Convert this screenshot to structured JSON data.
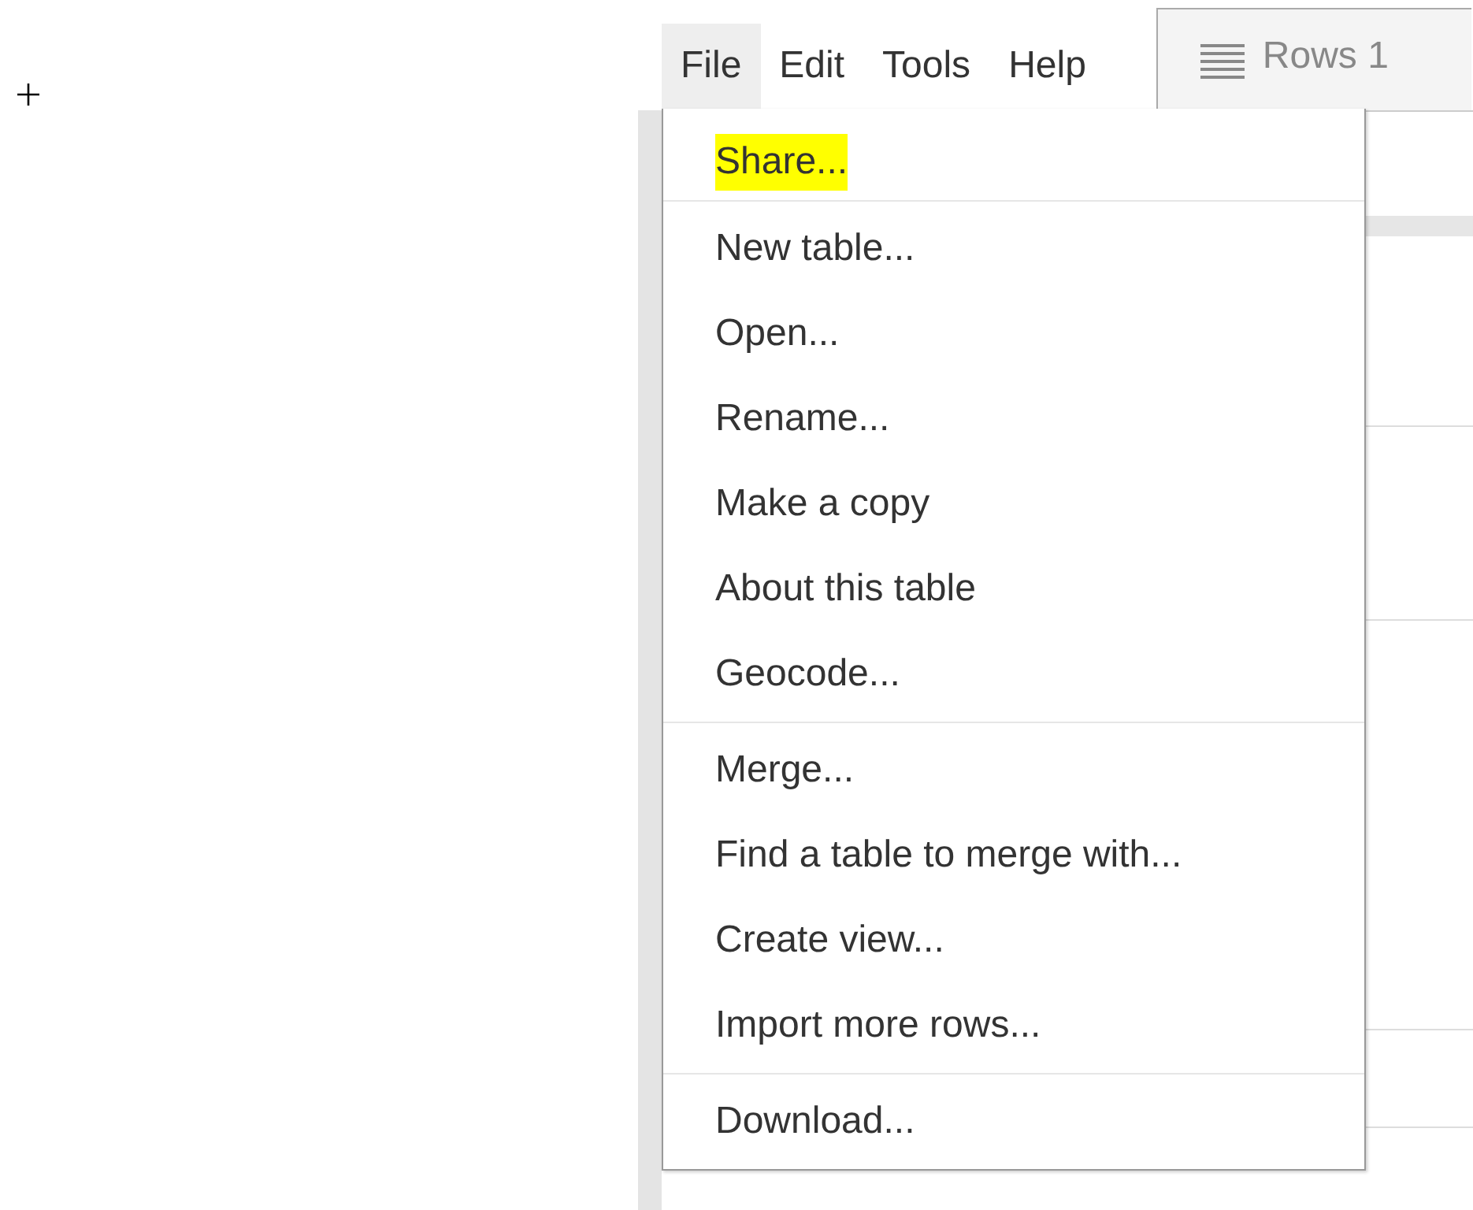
{
  "menubar": [
    {
      "label": "File",
      "selected": true
    },
    {
      "label": "Edit",
      "selected": false
    },
    {
      "label": "Tools",
      "selected": false
    },
    {
      "label": "Help",
      "selected": false
    }
  ],
  "tab": {
    "label": "Rows 1"
  },
  "file_menu": {
    "groups": [
      [
        {
          "label": "Share...",
          "highlighted": true
        }
      ],
      [
        {
          "label": "New table...",
          "highlighted": false
        },
        {
          "label": "Open...",
          "highlighted": false
        },
        {
          "label": "Rename...",
          "highlighted": false
        },
        {
          "label": "Make a copy",
          "highlighted": false
        },
        {
          "label": "About this table",
          "highlighted": false
        },
        {
          "label": "Geocode...",
          "highlighted": false
        }
      ],
      [
        {
          "label": "Merge...",
          "highlighted": false
        },
        {
          "label": "Find a table to merge with...",
          "highlighted": false
        },
        {
          "label": "Create view...",
          "highlighted": false
        },
        {
          "label": "Import more rows...",
          "highlighted": false
        }
      ],
      [
        {
          "label": "Download...",
          "highlighted": false
        }
      ]
    ]
  }
}
